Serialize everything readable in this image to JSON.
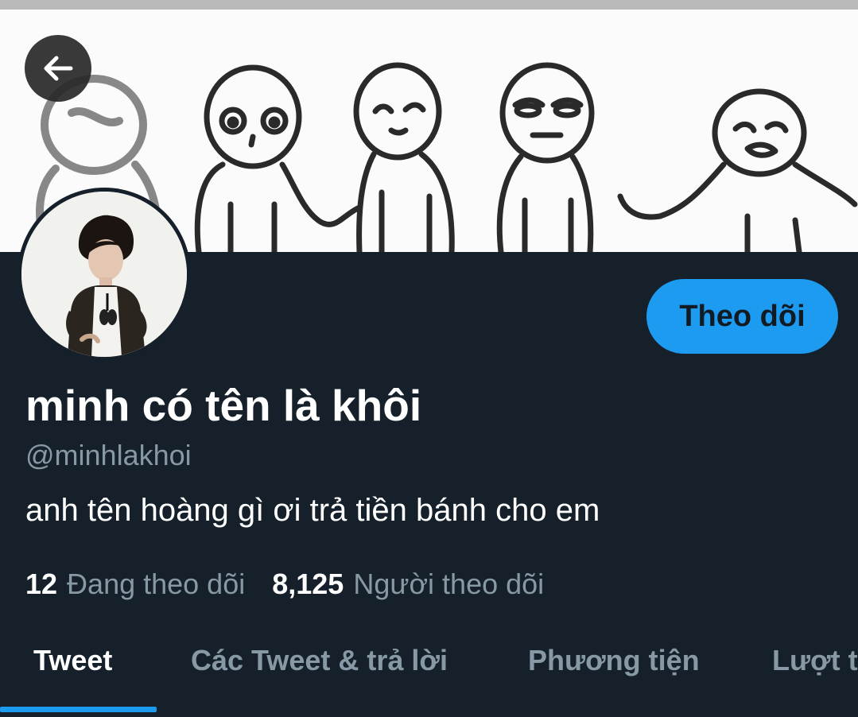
{
  "profile": {
    "display_name": "minh có tên là khôi",
    "handle": "@minhlakhoi",
    "bio": "anh tên hoàng gì ơi trả tiền bánh cho em",
    "follow_label": "Theo dõi"
  },
  "stats": {
    "following_count": "12",
    "following_label": "Đang theo dõi",
    "followers_count": "8,125",
    "followers_label": "Người theo dõi"
  },
  "tabs": [
    {
      "label": "Tweet",
      "active": true
    },
    {
      "label": "Các Tweet & trả lời",
      "active": false
    },
    {
      "label": "Phương tiện",
      "active": false
    },
    {
      "label": "Lượt thích",
      "active": false
    }
  ],
  "colors": {
    "background": "#15202b",
    "accent": "#1d9bf0",
    "muted_text": "#8899a6",
    "text": "#ffffff"
  },
  "icons": {
    "back": "arrow-left-icon"
  }
}
